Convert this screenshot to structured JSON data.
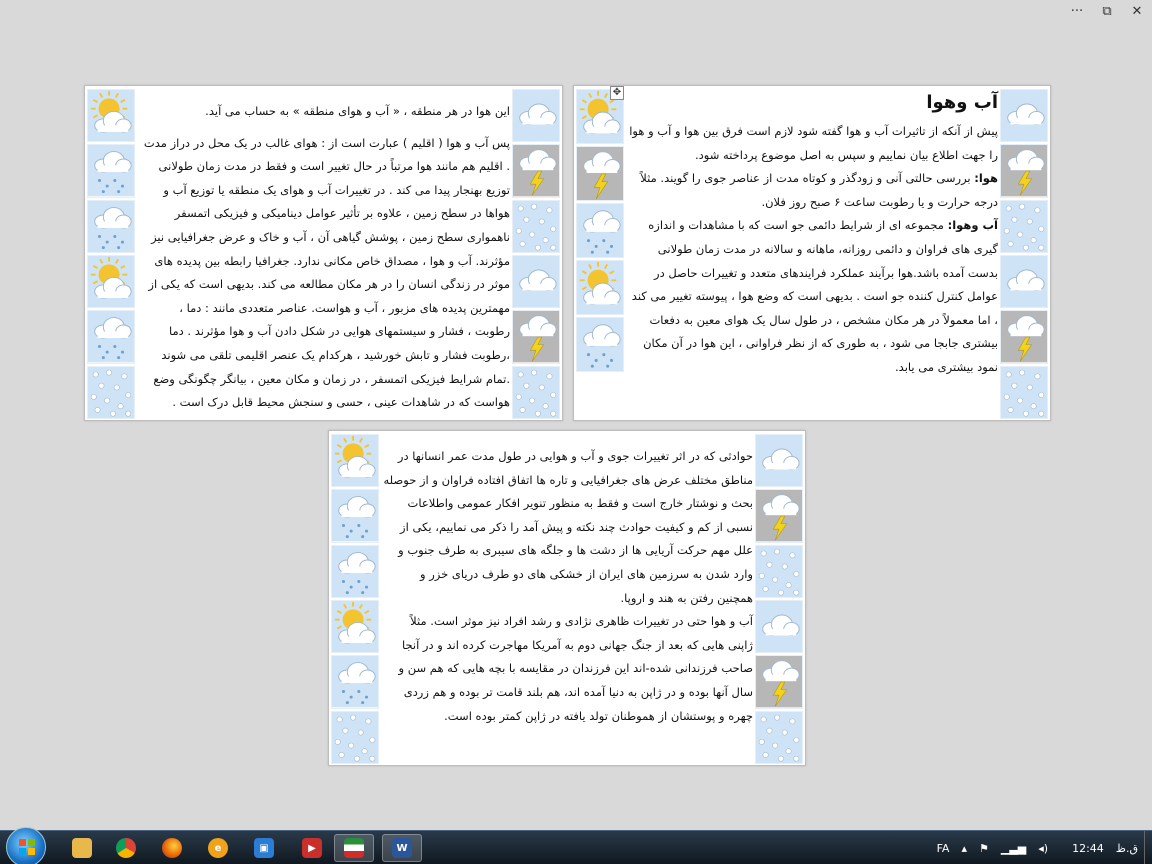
{
  "window": {
    "more_label": "···",
    "restore_label": "⧉",
    "close_label": "✕"
  },
  "page1": {
    "title": "آب وهوا",
    "paragraphs": [
      {
        "bold": "",
        "text": "پیش از آنکه از تاثیرات آب و هوا گفته شود لازم است فرق بین هوا و آب و هوا را جهت اطلاع بیان نماییم و سپس به اصل موضوع پرداخته شود."
      },
      {
        "bold": "هوا:",
        "text": " بررسی حالتی آنی و زودگذر و کوتاه مدت از عناصر جوی را گویند. مثلاً درجه حرارت و یا رطوبت ساعت ۶ صبح روز فلان."
      },
      {
        "bold": "آب وهوا:",
        "text": " مجموعه ای از شرایط دائمی جو است که با مشاهدات و اندازه گیری های فراوان و دائمی روزانه، ماهانه و سالانه در مدت زمان طولانی بدست آمده باشد.هوا برآیند عملکرد فرایندهای متعدد و تغییرات حاصل در عوامل کنترل کننده جو است . بدیهی است که وضع هوا ، پیوسته تغییر می کند ، اما معمولاً در هر مکان مشخص ، در طول سال یک هوای معین به دفعات بیشتری جابجا می شود ، به طوری که از نظر فراوانی ، این هوا در آن مکان نمود بیشتری می یابد."
      }
    ]
  },
  "page2": {
    "paragraphs": [
      "این هوا در هر منطقه ، « آب و هوای منطقه » به حساب می آید.",
      "پس آب و هوا ( اقلیم ) عبارت است از : هوای غالب در یک محل در دراز مدت . اقلیم هم مانند هوا مرتباً در حال تغییر است و فقط در مدت زمان طولانی توزیع بهنجار پیدا می کند . در تغییرات آب و هوای یک منطقه یا توزیع آب و هواها در سطح زمین ، علاوه بر تأثیر عوامل دینامیکی و فیزیکی اتمسفر ناهمواری سطح زمین ، پوشش گیاهی آن ، آب و خاک و عرض جغرافیایی نیز مؤثرند. آب و هوا ، مصداق خاص مکانی ندارد. جغرافیا رابطه بین پدیده های موثر در زندگی انسان را در هر مکان مطالعه می کند. بدیهی است که یکی از مهمترین پدیده های مزبور ، آب و هواست. عناصر متعددی مانند : دما ، رطوبت ، فشار و سیستمهای هوایی در شکل دادن آب و هوا مؤثرند . دما ،رطوبت فشار و تابش خورشید ، هرکدام یک عنصر اقلیمی تلقی می شوند .تمام شرایط فیزیکی اتمسفر ، در زمان و مکان معین ، بیانگر چگونگی وضع هواست که در شاهدات عینی ، حسی و سنجش محیط قابل درک است ."
    ]
  },
  "page3": {
    "paragraphs": [
      "حوادثی که در اثر تغییرات جوی و آب و هوایی در طول مدت عمر انسانها در مناطق مختلف عرض های جغرافیایی و تاره ها اتفاق افتاده فراوان و از حوصله بحث و نوشتار خارج است و فقط به منظور تنویر افکار عمومی واطلاعات نسبی از کم و کیفیت حوادث چند نکته و پیش آمد را ذکر می نماییم، یکی از علل مهم حرکت آریایی ها از دشت ها و جلگه های سیبری به طرف جنوب و وارد شدن به سرزمین های ایران از خشکی های دو طرف دریای خزر و همچنین رفتن به هند و اروپا.",
      "آب و هوا حتی در تغییرات ظاهری نژادی و رشد افراد نیز موثر است. مثلاً ژاپنی هایی که بعد از جنگ جهانی دوم به آمریکا مهاجرت کرده اند و در آنجا صاحب فرزندانی شده-اند این فرزندان در مقایسه با بچه هایی که هم سن و سال آنها بوده و در ژاپن به دنیا آمده اند، هم بلند قامت تر بوده و هم زردی چهره و پوستشان از هموطنان تولد یافته در ژاپن کمتر بوده است."
    ]
  },
  "icons": {
    "sun": "sun-cloud-icon",
    "cloud": "cloud-icon",
    "rain": "rain-cloud-icon",
    "storm": "thunder-cloud-icon",
    "snow": "snow-icon"
  },
  "taskbar": {
    "apps": [
      "file-explorer",
      "chrome",
      "firefox",
      "edge",
      "app-blue",
      "app-red",
      "app-flag",
      "word"
    ],
    "lang": "FA",
    "ampm": "ق.ظ",
    "time": "12:44"
  },
  "colors": {
    "sky": "#cfe3f7",
    "sun": "#f4c430",
    "storm_bg": "#b7b7b7",
    "bolt": "#f2d21a"
  }
}
